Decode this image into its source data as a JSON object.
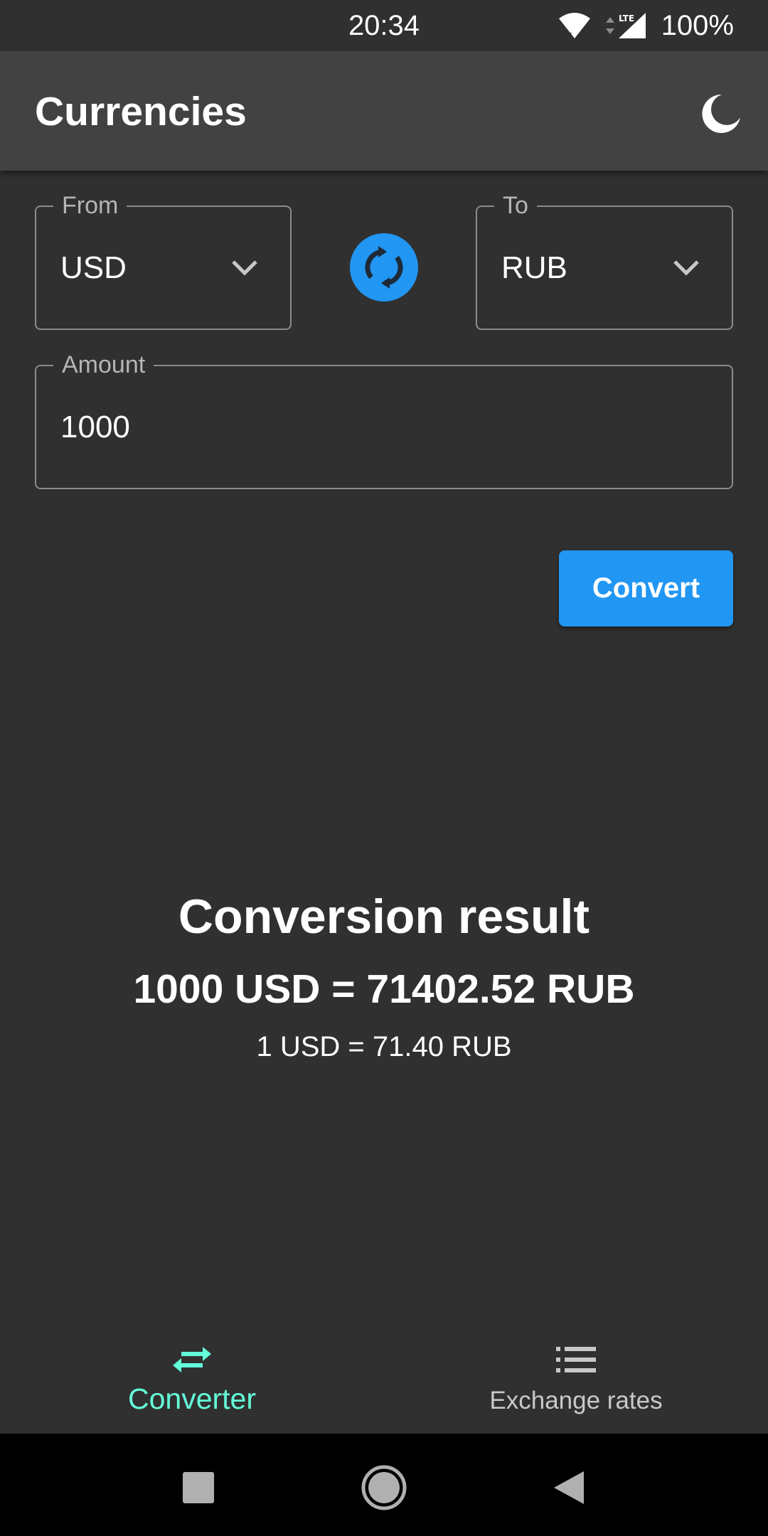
{
  "status_bar": {
    "time": "20:34",
    "network": "LTE",
    "battery": "100%"
  },
  "app_bar": {
    "title": "Currencies",
    "theme_icon": "moon-icon"
  },
  "from_field": {
    "label": "From",
    "value": "USD"
  },
  "to_field": {
    "label": "To",
    "value": "RUB"
  },
  "amount_field": {
    "label": "Amount",
    "value": "1000"
  },
  "convert_button": {
    "label": "Convert"
  },
  "result": {
    "title": "Conversion result",
    "main": "1000 USD = 71402.52 RUB",
    "rate": "1 USD = 71.40 RUB"
  },
  "bottom_nav": {
    "items": [
      {
        "label": "Converter",
        "icon": "swap-arrows-icon",
        "active": true
      },
      {
        "label": "Exchange rates",
        "icon": "list-icon",
        "active": false
      }
    ]
  },
  "colors": {
    "accent": "#2196f3",
    "active_nav": "#64ffda",
    "background": "#303030",
    "app_bar": "#424242"
  }
}
